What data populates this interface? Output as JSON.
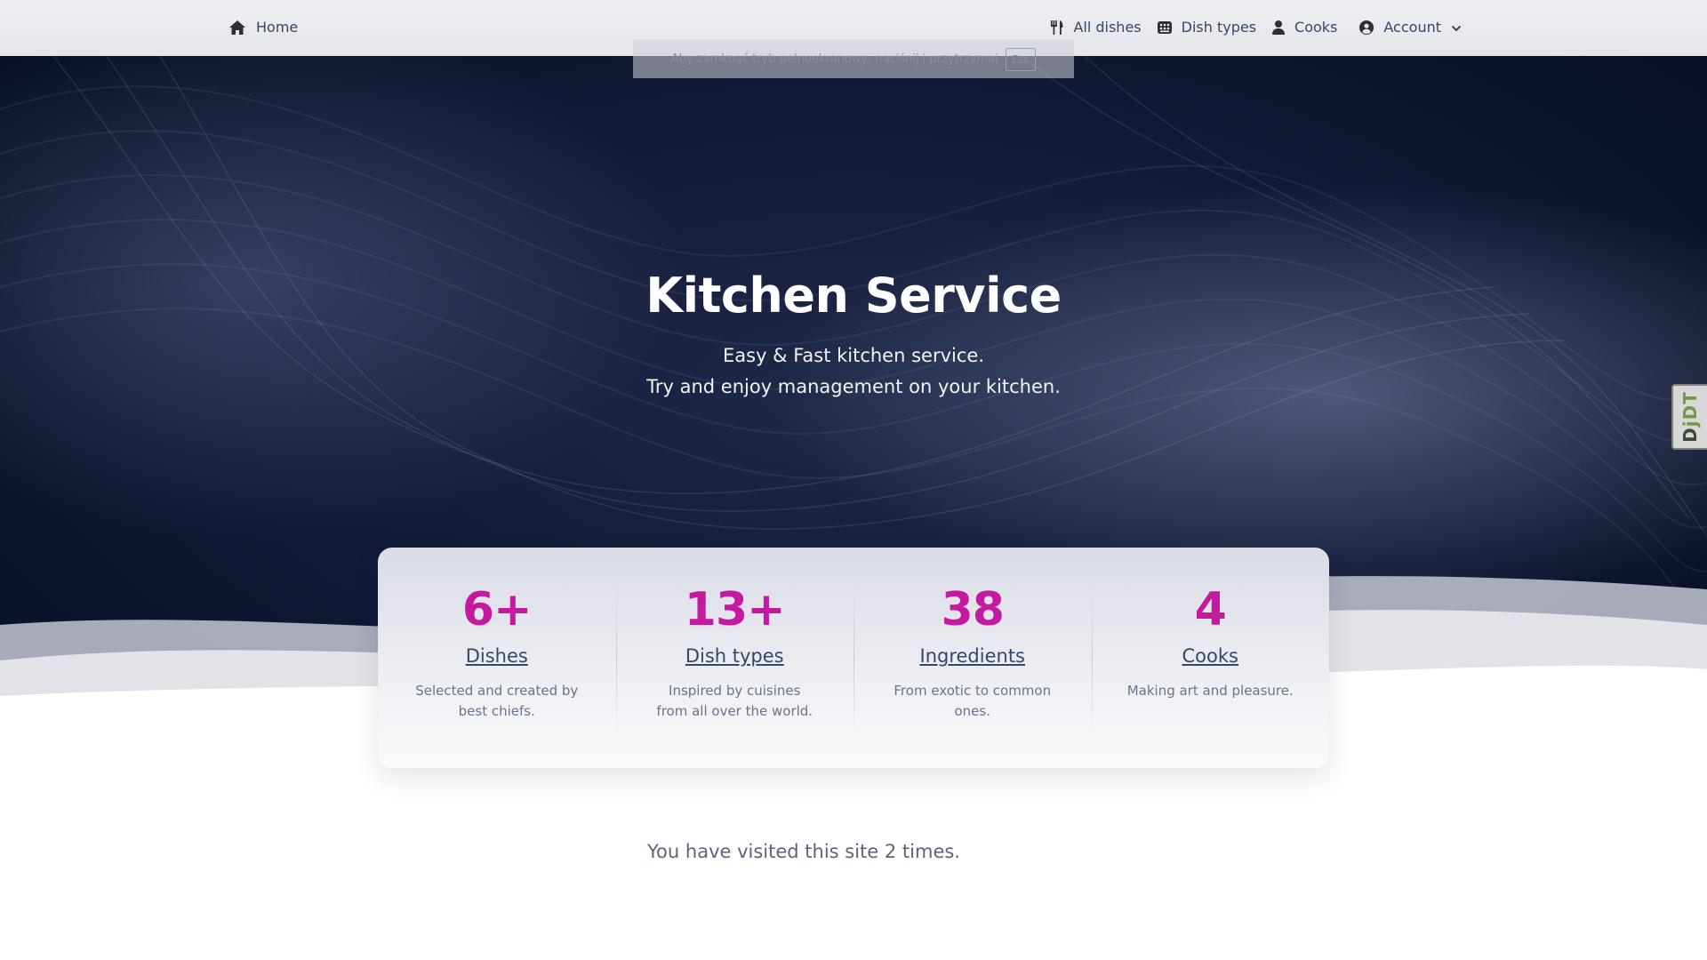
{
  "navbar": {
    "home_label": "Home",
    "all_dishes_label": "All dishes",
    "dish_types_label": "Dish types",
    "cooks_label": "Cooks",
    "account_label": "Account"
  },
  "fullscreen_notice": {
    "text": "Aby zamknąć tryb pełnoekranowy, naciśnij i przytrzymaj",
    "key": "Esc"
  },
  "hero": {
    "title": "Kitchen Service",
    "subtitle_line1": "Easy & Fast kitchen service.",
    "subtitle_line2": "Try and enjoy management on your kitchen."
  },
  "stats": [
    {
      "value": "6+",
      "title": "Dishes",
      "desc": "Selected and created by best chiefs."
    },
    {
      "value": "13+",
      "title": "Dish types",
      "desc": "Inspired by cuisines from all over the world."
    },
    {
      "value": "38",
      "title": "Ingredients",
      "desc": "From exotic to common ones."
    },
    {
      "value": "4",
      "title": "Cooks",
      "desc": "Making art and pleasure."
    }
  ],
  "visits_text": "You have visited this site 2 times.",
  "djdt_label": "DjDT",
  "colors": {
    "accent": "#c519a0",
    "text_dark": "#344767",
    "hero_bg": "#111936"
  }
}
